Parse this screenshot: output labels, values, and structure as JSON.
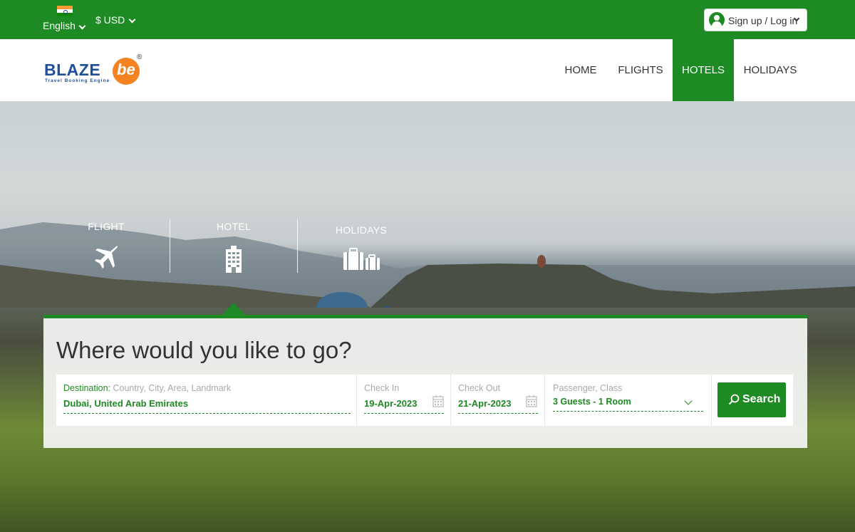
{
  "topbar": {
    "language": "English",
    "currency": "$ USD",
    "signup_label": "Sign up / Log in"
  },
  "brand": {
    "name": "BLAZE",
    "suffix": "be",
    "registered": "®",
    "tagline": "Travel Booking Engine"
  },
  "nav": {
    "items": [
      {
        "label": "HOME"
      },
      {
        "label": "FLIGHTS"
      },
      {
        "label": "HOTELS"
      },
      {
        "label": "HOLIDAYS"
      }
    ],
    "active": "HOTELS"
  },
  "tabs": [
    {
      "label": "FLIGHT",
      "icon": "airplane-icon"
    },
    {
      "label": "HOTEL",
      "icon": "hotel-building-icon"
    },
    {
      "label": "HOLIDAYS",
      "icon": "luggage-icon"
    }
  ],
  "search": {
    "title": "Where would you like to go?",
    "destination_label": "Destination:",
    "destination_placeholder": "Country, City, Area, Landmark",
    "destination_value": "Dubai, United Arab Emirates",
    "checkin_label": "Check In",
    "checkin_value": "19-Apr-2023",
    "checkout_label": "Check Out",
    "checkout_value": "21-Apr-2023",
    "passenger_label": "Passenger, Class",
    "passenger_value": "3 Guests - 1 Room",
    "button_label": "Search"
  },
  "colors": {
    "primary_green": "#1e8a23",
    "brand_blue": "#1f4f9b",
    "brand_orange": "#f58220"
  }
}
